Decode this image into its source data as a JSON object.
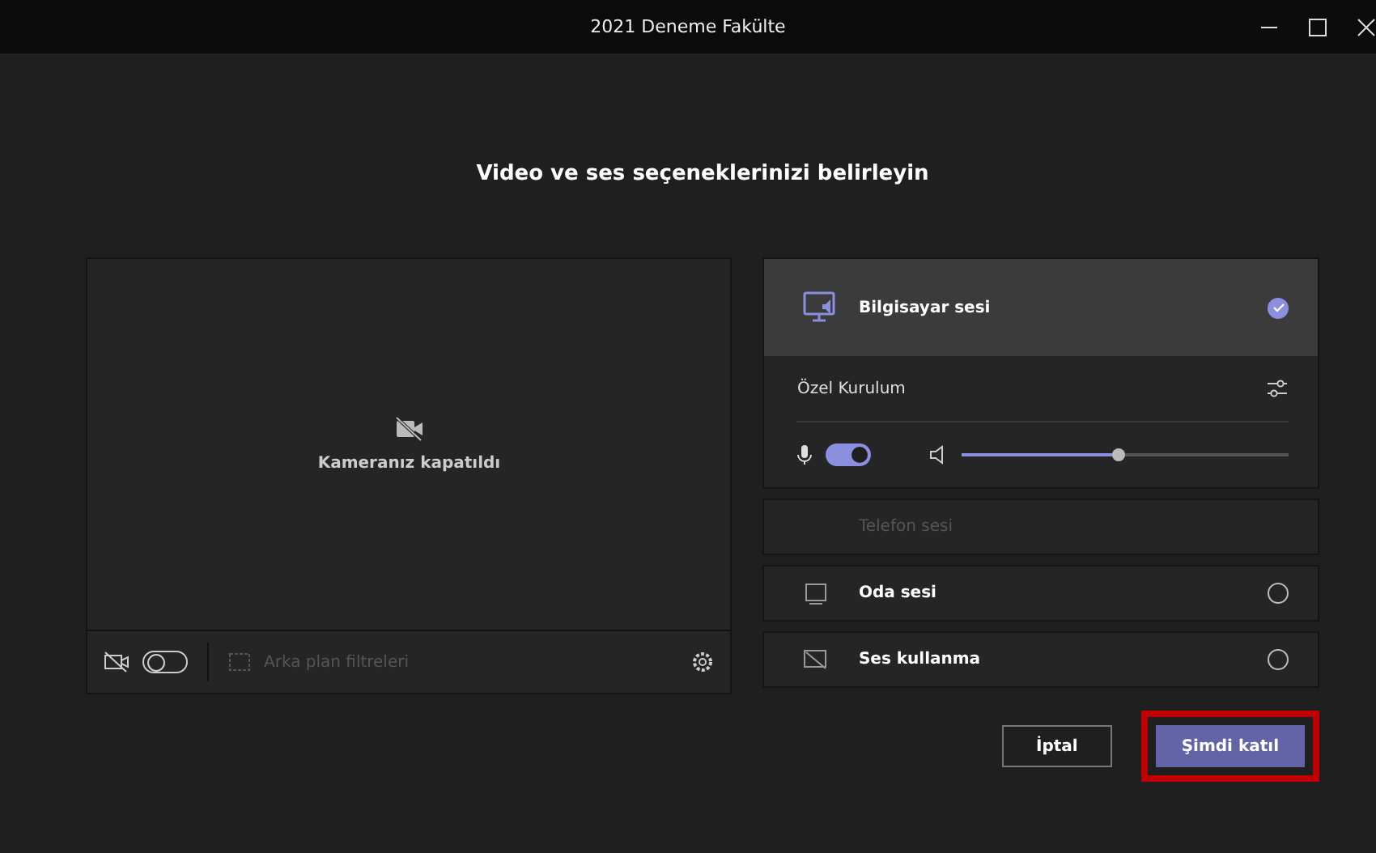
{
  "window": {
    "title": "2021 Deneme Fakülte"
  },
  "heading": "Video ve ses seçeneklerinizi belirleyin",
  "camera": {
    "status": "Kameranız kapatıldı",
    "on": false,
    "background_filters": "Arka plan filtreleri"
  },
  "audio_options": [
    {
      "kind": "computer",
      "label": "Bilgisayar sesi",
      "selected": true,
      "disabled": false
    },
    {
      "kind": "phone",
      "label": "Telefon sesi",
      "selected": false,
      "disabled": true
    },
    {
      "kind": "room",
      "label": "Oda sesi",
      "selected": false,
      "disabled": false
    },
    {
      "kind": "none",
      "label": "Ses kullanma",
      "selected": false,
      "disabled": false
    }
  ],
  "custom_setup": {
    "label": "Özel Kurulum",
    "mic_on": true,
    "volume": {
      "level": 0.48
    }
  },
  "buttons": [
    {
      "label": "İptal",
      "kind": "secondary",
      "highlighted": false
    },
    {
      "label": "Şimdi katıl",
      "kind": "primary",
      "highlighted": true
    }
  ]
}
